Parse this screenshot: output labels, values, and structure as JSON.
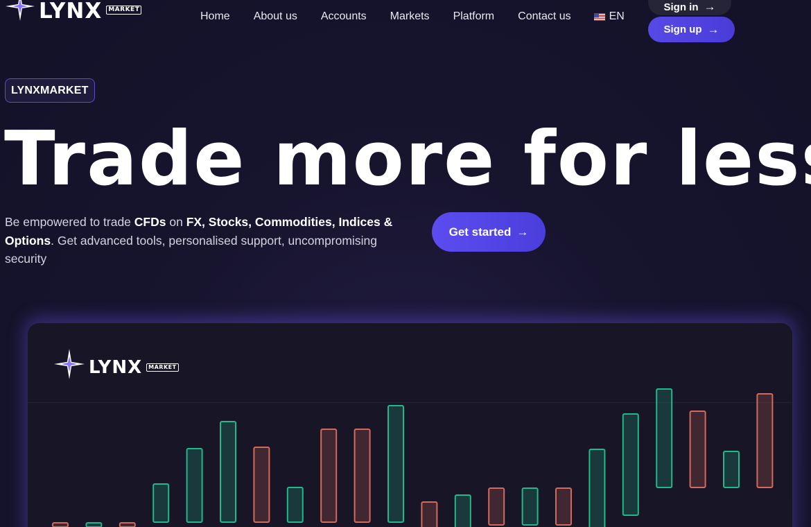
{
  "brand": {
    "name": "LYNX",
    "tag": "MARKET"
  },
  "nav": {
    "items": [
      "Home",
      "About us",
      "Accounts",
      "Markets",
      "Platform",
      "Contact us"
    ],
    "lang": "EN"
  },
  "auth": {
    "signin_label": "Sign in",
    "signup_label": "Sign up",
    "arrow": "→"
  },
  "hero": {
    "badge": "LYNXMARKET",
    "title": "Trade more for less",
    "desc": {
      "p1": "Be empowered to trade ",
      "b1": "CFDs",
      "p2": " on ",
      "b2": "FX, Stocks, Commodities, Indices & Options",
      "p3": ". Get advanced tools, personalised support, uncompromising security"
    },
    "cta_label": "Get started"
  },
  "colors": {
    "accent": "#5649e6",
    "bull": "#1fb98a",
    "bear": "#d46a5a"
  },
  "chart_data": {
    "type": "bar",
    "categories": [],
    "series": [
      {
        "values": [
          [
            1,
            0,
            "bear"
          ],
          [
            1,
            0,
            "bull"
          ],
          [
            1,
            0,
            "bear"
          ],
          [
            1,
            56,
            "bull"
          ],
          [
            1,
            107,
            "bull"
          ],
          [
            1,
            146,
            "bull"
          ],
          [
            1,
            109,
            "bear"
          ],
          [
            1,
            51,
            "bull"
          ],
          [
            1,
            135,
            "bear"
          ],
          [
            1,
            135,
            "bear"
          ],
          [
            1,
            169,
            "bull"
          ],
          [
            -36,
            30,
            "bear"
          ],
          [
            -36,
            40,
            "bull"
          ],
          [
            -3,
            50,
            "bear"
          ],
          [
            -3,
            50,
            "bull"
          ],
          [
            -3,
            50,
            "bear"
          ],
          [
            -36,
            106,
            "bull"
          ],
          [
            11,
            157,
            "bull"
          ],
          [
            51,
            193,
            "bull"
          ],
          [
            51,
            161,
            "bear"
          ],
          [
            51,
            103,
            "bull"
          ],
          [
            51,
            186,
            "bear"
          ]
        ]
      }
    ]
  }
}
